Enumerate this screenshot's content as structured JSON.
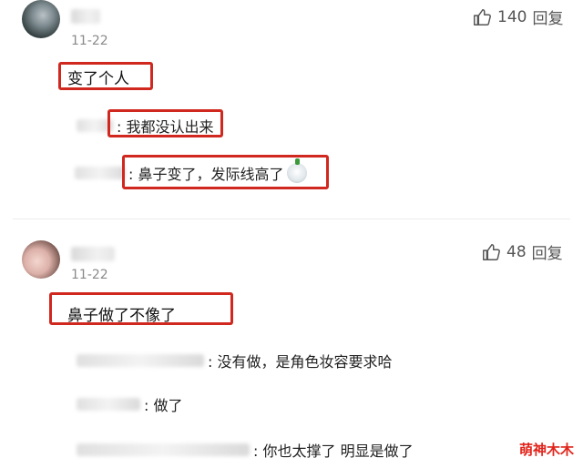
{
  "comments": [
    {
      "date": "11-22",
      "likes": "140",
      "reply_label": "回复",
      "text": "变了个人",
      "replies": [
        {
          "text": ": 我都没认出来"
        },
        {
          "text": ": 鼻子变了，发际线高了"
        }
      ]
    },
    {
      "date": "11-22",
      "likes": "48",
      "reply_label": "回复",
      "text": "鼻子做了不像了",
      "replies": [
        {
          "text": ": 没有做，是角色妆容要求哈"
        },
        {
          "text": ": 做了"
        },
        {
          "text": ": 你也太撑了 明显是做了"
        }
      ]
    }
  ],
  "watermark": "萌神木木",
  "colors": {
    "highlight": "#d0281e",
    "muted": "#8a8a8a"
  },
  "icons": [
    "thumbs-up-icon",
    "crying-emoji-icon"
  ]
}
